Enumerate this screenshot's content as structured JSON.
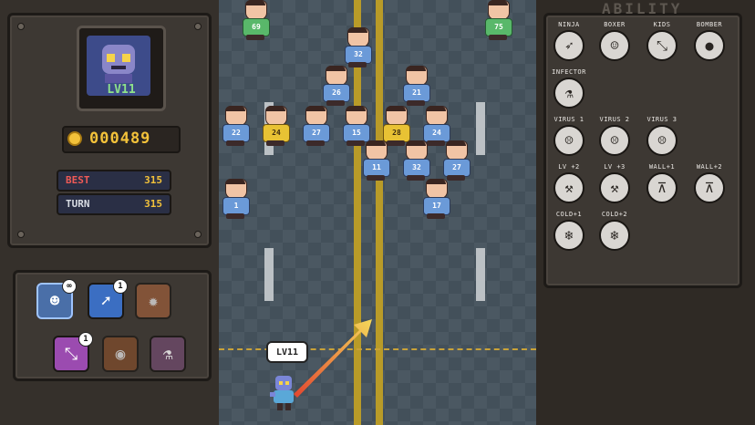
{
  "player": {
    "level_label": "LV11",
    "bubble_label": "LV11",
    "coins": "000489",
    "best_label": "BEST",
    "best_value": "315",
    "turn_label": "TURN",
    "turn_value": "315"
  },
  "items": [
    {
      "icon": "zombie-face-icon",
      "badge": "∞",
      "color": "#4a6fa8"
    },
    {
      "icon": "arrow-up-right-icon",
      "badge": "1",
      "color": "#3b6ec2"
    },
    {
      "icon": "fire-icon",
      "badge": "",
      "color": "#a8623b"
    },
    {
      "icon": "split-arrows-icon",
      "badge": "1",
      "color": "#9b4bb0"
    },
    {
      "icon": "bomb-icon",
      "badge": "",
      "color": "#8a4f2a"
    },
    {
      "icon": "potion-icon",
      "badge": "",
      "color": "#6e4a6a"
    }
  ],
  "ability": {
    "title": "ABILITY",
    "rows": [
      [
        "NINJA",
        "BOXER",
        "KIDS",
        "BOMBER"
      ],
      [
        "INFECTOR"
      ],
      [
        "VIRUS 1",
        "VIRUS 2",
        "VIRUS 3"
      ],
      [
        "LV +2",
        "LV +3",
        "WALL+1",
        "WALL+2"
      ],
      [
        "COLD+1",
        "COLD+2"
      ]
    ]
  },
  "enemies": [
    {
      "n": "69",
      "color": "green"
    },
    {
      "n": "75",
      "color": "green"
    },
    {
      "n": "32",
      "color": "blue"
    },
    {
      "n": "26",
      "color": "blue"
    },
    {
      "n": "21",
      "color": "blue"
    },
    {
      "n": "22",
      "color": "blue"
    },
    {
      "n": "24",
      "color": "yellow"
    },
    {
      "n": "27",
      "color": "blue"
    },
    {
      "n": "15",
      "color": "blue"
    },
    {
      "n": "28",
      "color": "yellow"
    },
    {
      "n": "24",
      "color": "blue"
    },
    {
      "n": "11",
      "color": "blue"
    },
    {
      "n": "32",
      "color": "blue"
    },
    {
      "n": "27",
      "color": "blue"
    },
    {
      "n": "1",
      "color": "blue"
    },
    {
      "n": "17",
      "color": "blue"
    }
  ],
  "colors": {
    "road": "#43505a",
    "road_center_line": "#b99b28",
    "coin": "#f3c23a",
    "best_label": "#ef5a56"
  }
}
